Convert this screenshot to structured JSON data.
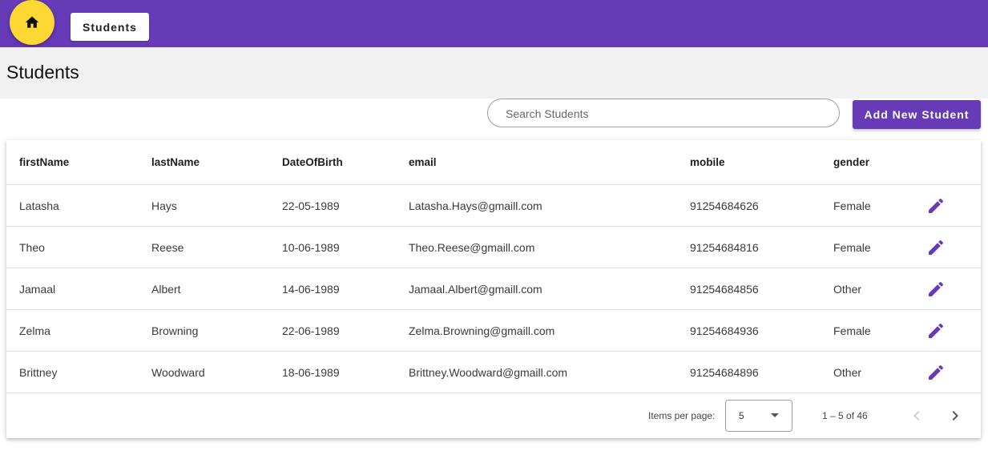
{
  "app": {
    "nav_button_label": "Students",
    "home_icon": "home-icon"
  },
  "page": {
    "title": "Students"
  },
  "toolbar": {
    "search_placeholder": "Search Students",
    "search_value": "",
    "add_button_label": "Add New Student"
  },
  "colors": {
    "primary": "#673ab7",
    "accent": "#fdd835"
  },
  "table": {
    "columns": [
      "firstName",
      "lastName",
      "DateOfBirth",
      "email",
      "mobile",
      "gender"
    ],
    "rows": [
      [
        "Latasha",
        "Hays",
        "22-05-1989",
        "Latasha.Hays@gmaill.com",
        "91254684626",
        "Female"
      ],
      [
        "Theo",
        "Reese",
        "10-06-1989",
        "Theo.Reese@gmaill.com",
        "91254684816",
        "Female"
      ],
      [
        "Jamaal",
        "Albert",
        "14-06-1989",
        "Jamaal.Albert@gmaill.com",
        "91254684856",
        "Other"
      ],
      [
        "Zelma",
        "Browning",
        "22-06-1989",
        "Zelma.Browning@gmaill.com",
        "91254684936",
        "Female"
      ],
      [
        "Brittney",
        "Woodward",
        "18-06-1989",
        "Brittney.Woodward@gmaill.com",
        "91254684896",
        "Other"
      ]
    ],
    "row_action_icon": "edit-icon"
  },
  "paginator": {
    "items_per_page_label": "Items per page:",
    "items_per_page_value": "5",
    "range_label": "1 – 5 of 46",
    "prev_icon": "chevron-left-icon",
    "next_icon": "chevron-right-icon"
  }
}
